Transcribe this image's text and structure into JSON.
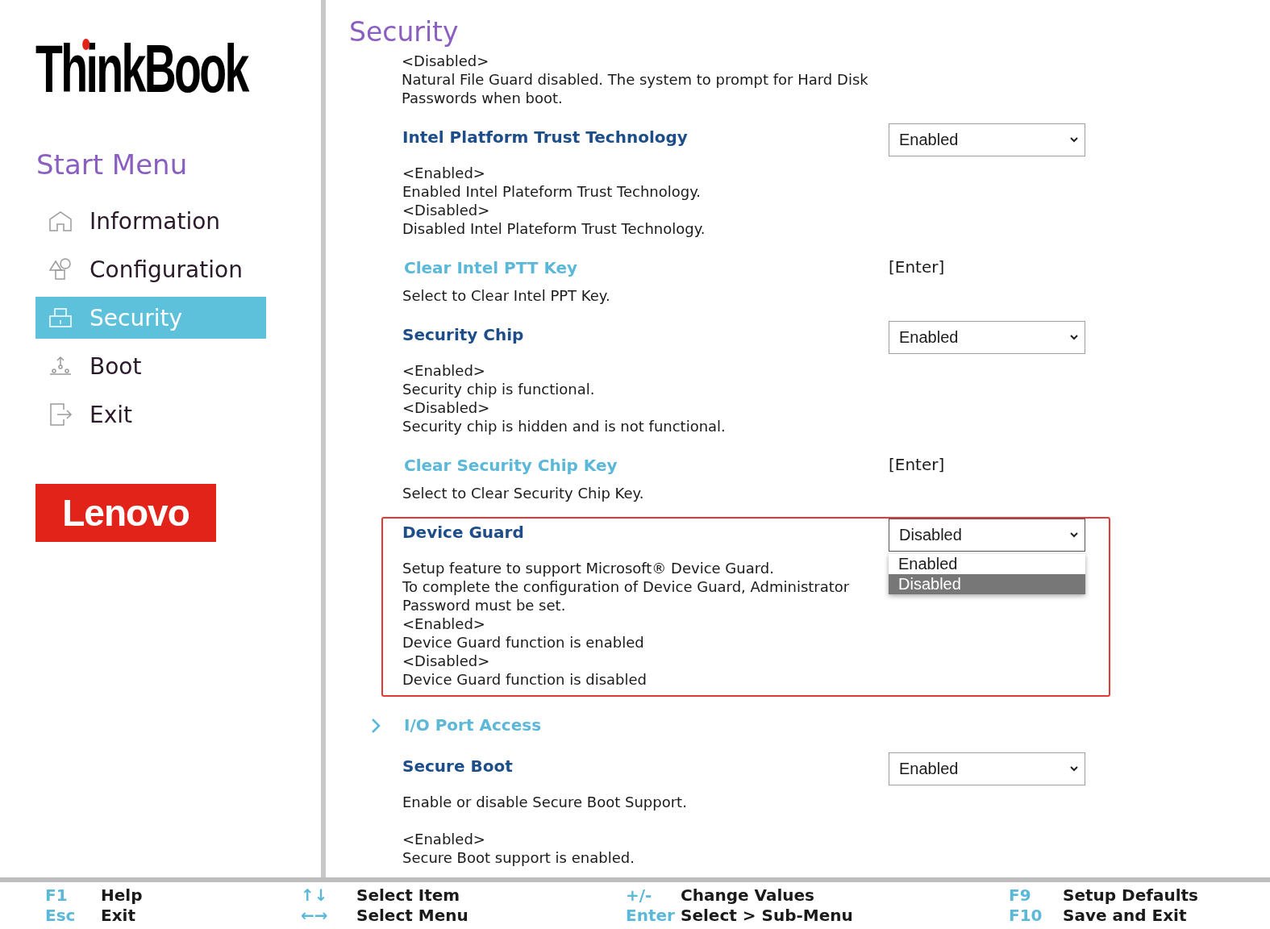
{
  "sidebar": {
    "brand": "ThinkBook",
    "menu_title": "Start Menu",
    "items": [
      {
        "label": "Information",
        "selected": false
      },
      {
        "label": "Configuration",
        "selected": false
      },
      {
        "label": "Security",
        "selected": true
      },
      {
        "label": "Boot",
        "selected": false
      },
      {
        "label": "Exit",
        "selected": false
      }
    ],
    "vendor_logo": "Lenovo"
  },
  "page": {
    "title": "Security",
    "intro": [
      "<Disabled>",
      "Natural File Guard disabled. The system to prompt for Hard Disk",
      "Passwords when boot."
    ],
    "settings": [
      {
        "kind": "select",
        "title": "Intel Platform Trust Technology",
        "value": "Enabled",
        "highlighted": false,
        "expanded": false,
        "description": [
          [
            "<Enabled>",
            "Enabled Intel Plateform Trust Technology.",
            "<Disabled>",
            "Disabled Intel Plateform Trust Technology."
          ]
        ]
      },
      {
        "kind": "action",
        "title": "Clear Intel PTT Key",
        "value": "[Enter]",
        "description": [
          [
            "Select to Clear Intel PPT Key."
          ]
        ]
      },
      {
        "kind": "select",
        "title": "Security Chip",
        "value": "Enabled",
        "highlighted": false,
        "expanded": false,
        "description": [
          [
            "<Enabled>",
            "Security chip is functional.",
            "<Disabled>",
            "Security chip is hidden and is not functional."
          ]
        ]
      },
      {
        "kind": "action",
        "title": "Clear Security Chip Key",
        "value": "[Enter]",
        "description": [
          [
            "Select to Clear Security Chip Key."
          ]
        ]
      },
      {
        "kind": "select",
        "title": "Device Guard",
        "value": "Disabled",
        "highlighted": true,
        "expanded": true,
        "options": [
          {
            "label": "Enabled",
            "selected": false
          },
          {
            "label": "Disabled",
            "selected": true
          }
        ],
        "description": [
          [
            "Setup feature to support Microsoft® Device Guard.",
            "To complete the configuration of Device Guard, Administrator",
            "Password must be set.",
            "<Enabled>",
            "Device Guard function is enabled",
            "<Disabled>",
            "Device Guard function is disabled"
          ]
        ]
      },
      {
        "kind": "submenu",
        "title": "I/O Port Access"
      },
      {
        "kind": "select",
        "title": "Secure Boot",
        "value": "Enabled",
        "highlighted": false,
        "expanded": false,
        "description": [
          [
            "Enable or disable Secure Boot Support."
          ],
          [
            "<Enabled>",
            "Secure Boot support is enabled."
          ]
        ]
      }
    ]
  },
  "footer": [
    {
      "key": "F1",
      "action": "Help"
    },
    {
      "key": "↑↓",
      "action": "Select Item"
    },
    {
      "key": "+/-",
      "action": "Change Values"
    },
    {
      "key": "F9",
      "action": "Setup Defaults"
    },
    {
      "key": "Esc",
      "action": "Exit"
    },
    {
      "key": "←→",
      "action": "Select Menu"
    },
    {
      "key": "Enter",
      "action": "Select > Sub-Menu"
    },
    {
      "key": "F10",
      "action": "Save and Exit"
    }
  ]
}
